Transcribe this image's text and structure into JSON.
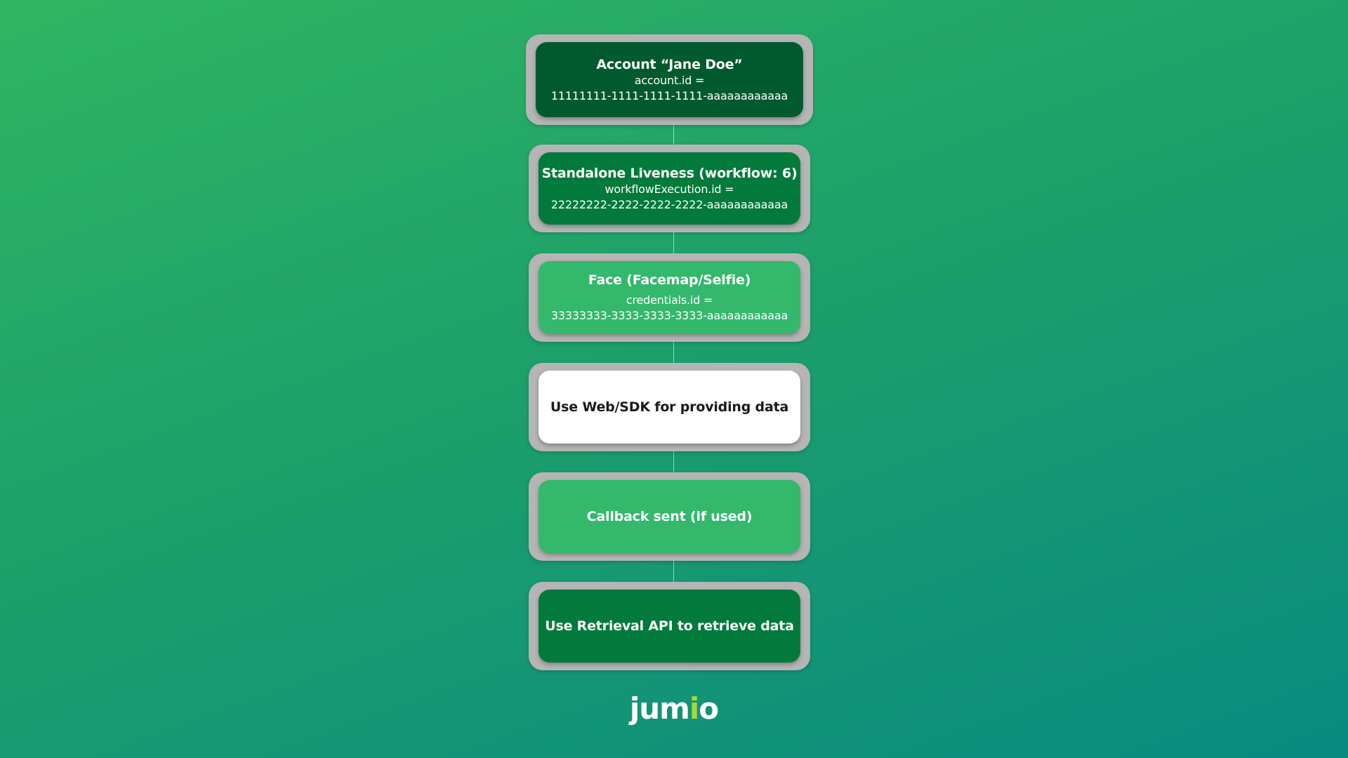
{
  "nodes": [
    {
      "title": "Account “Jane Doe”",
      "line1": "account.id =",
      "line2": "11111111-1111-1111-1111-aaaaaaaaaaaa",
      "style": "dark"
    },
    {
      "title": "Standalone Liveness (workflow: 6)",
      "line1": "workflowExecution.id =",
      "line2": "22222222-2222-2222-2222-aaaaaaaaaaaa",
      "style": "mid"
    },
    {
      "title": "Face (Facemap/Selfie)",
      "line1": "credentials.id =",
      "line2": "33333333-3333-3333-3333-aaaaaaaaaaaa",
      "style": "light"
    },
    {
      "title": "Use Web/SDK for providing data",
      "style": "white"
    },
    {
      "title": "Callback sent (if used)",
      "style": "light"
    },
    {
      "title": "Use Retrieval API to retrieve data",
      "style": "mid"
    }
  ],
  "logo": {
    "text_before": "jum",
    "text_accent": "i",
    "text_after": "o"
  },
  "colors": {
    "dark_green": "#005a2e",
    "mid_green": "#017a3c",
    "light_green": "#33b86c",
    "logo_accent": "#a8d63a"
  }
}
